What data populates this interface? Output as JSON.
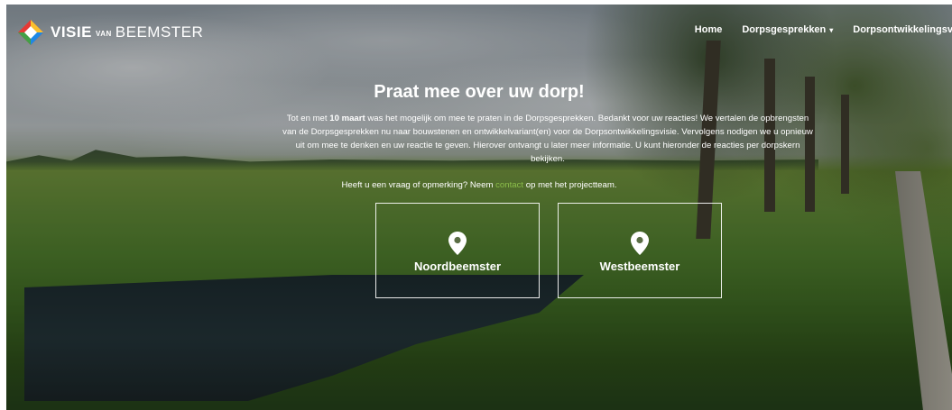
{
  "header": {
    "logo": {
      "word1": "VISIE",
      "van": "VAN",
      "word2": "BEEMSTER"
    },
    "nav": [
      {
        "label": "Home"
      },
      {
        "label": "Dorpsgesprekken"
      },
      {
        "label": "Dorpsontwikkelingsvi"
      }
    ]
  },
  "hero": {
    "title": "Praat mee over uw dorp!",
    "intro_prefix": "Tot en met ",
    "intro_bold": "10 maart",
    "intro_rest": " was het mogelijk om mee te praten in de Dorpsgesprekken. Bedankt voor uw reacties! We vertalen de opbrengsten van de Dorpsgesprekken nu naar bouwstenen en ontwikkelvariant(en) voor de Dorpsontwikkelingsvisie. Vervolgens nodigen we u opnieuw uit om mee te denken en uw reactie te geven. Hierover ontvangt u later meer informatie. U kunt hieronder de reacties per dorpskern bekijken.",
    "contact_prefix": "Heeft u een vraag of opmerking? Neem ",
    "contact_link": "contact",
    "contact_suffix": " op met het projectteam."
  },
  "cards": [
    {
      "label": "Noordbeemster",
      "icon": "map-pin-icon"
    },
    {
      "label": "Westbeemster",
      "icon": "map-pin-icon"
    }
  ],
  "colors": {
    "link": "#8bbf4a",
    "text": "#ffffff"
  }
}
